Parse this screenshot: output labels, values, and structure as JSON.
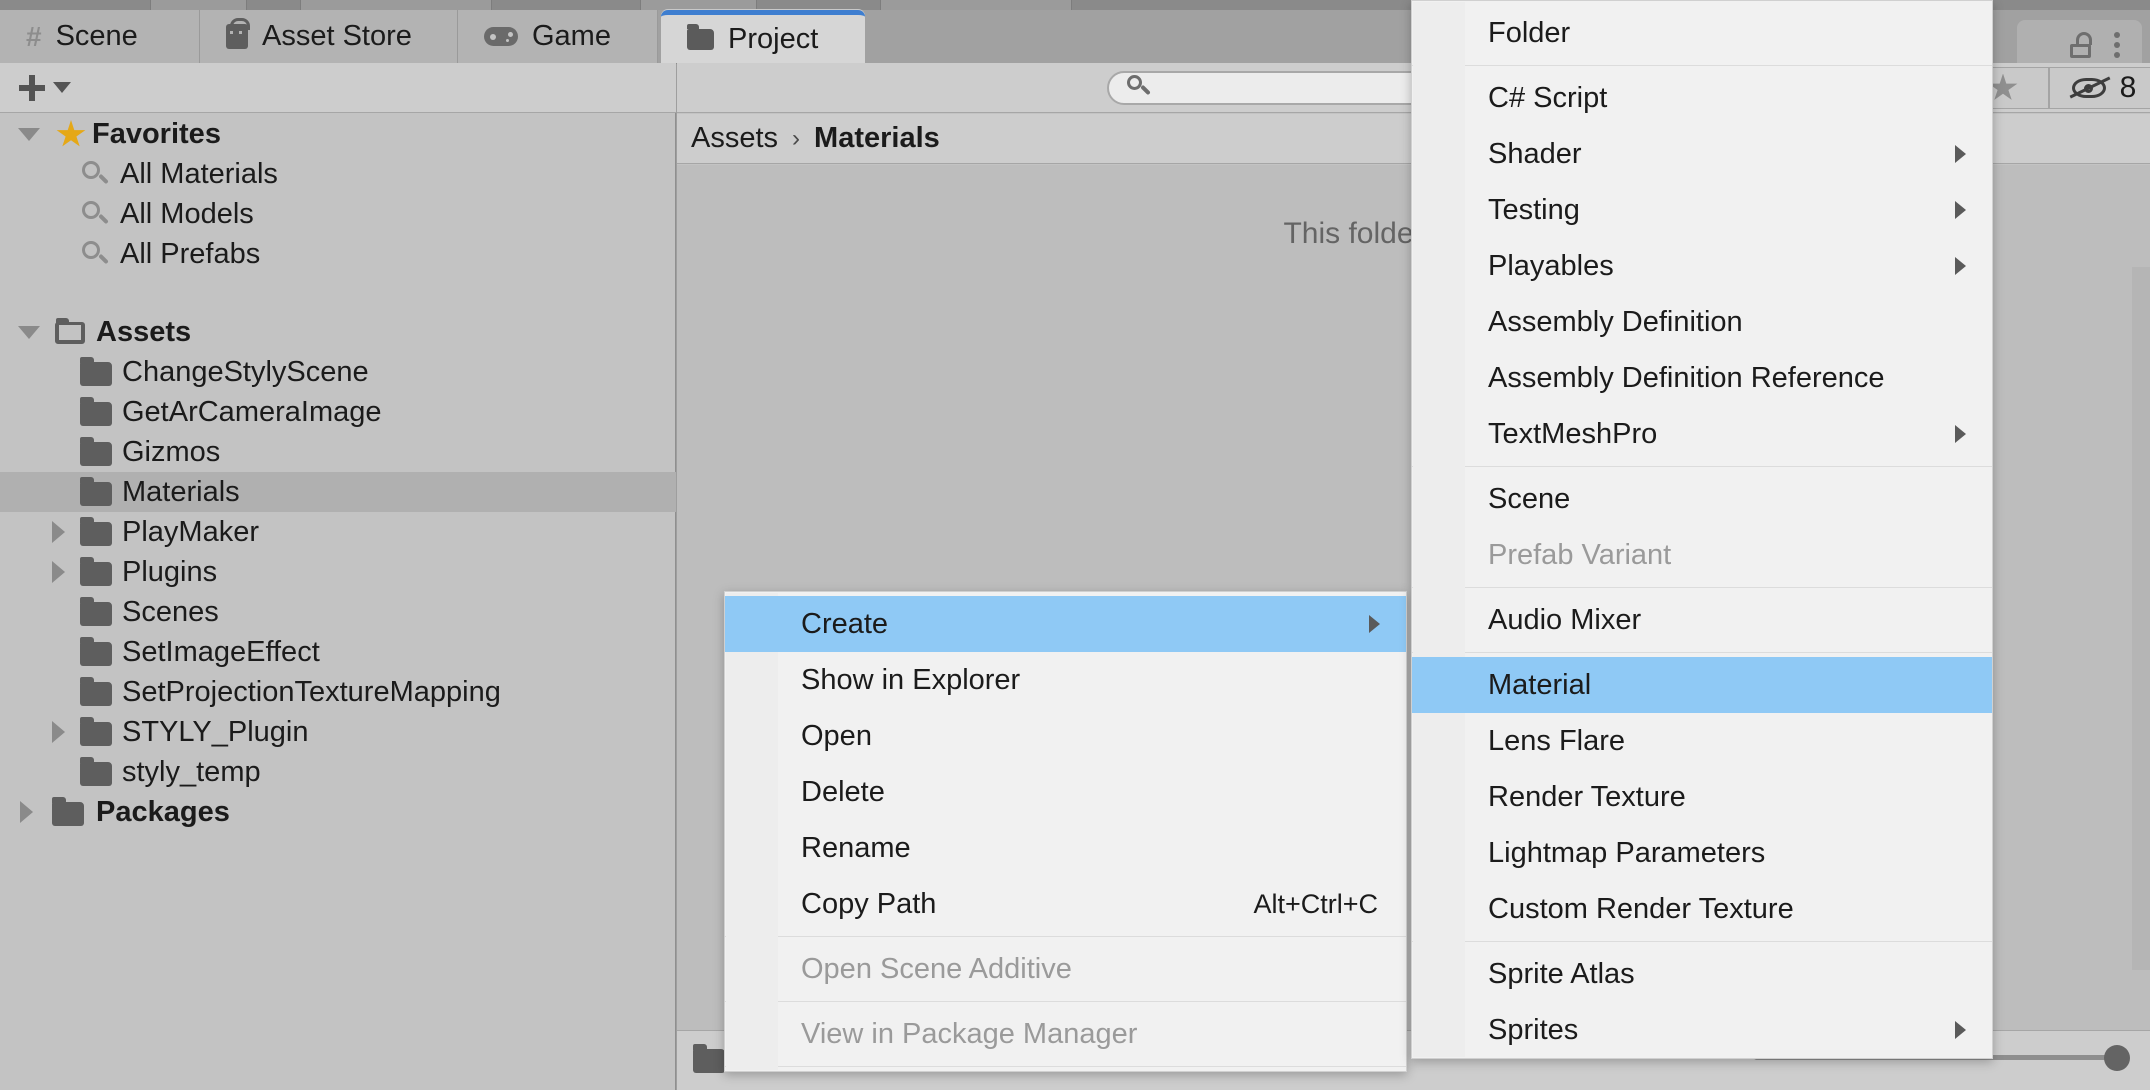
{
  "window": {
    "tabs": [
      {
        "label": "Scene",
        "icon": "grid-icon",
        "active": false
      },
      {
        "label": "Asset Store",
        "icon": "shopping-bag-icon",
        "active": false
      },
      {
        "label": "Game",
        "icon": "gamepad-icon",
        "active": false
      },
      {
        "label": "Project",
        "icon": "folder-icon",
        "active": true
      }
    ],
    "lock_icon": "lock-icon",
    "menu_icon": "kebab-menu-icon",
    "accent_color": "#3e7ed0"
  },
  "left_panel": {
    "toolbar": {
      "add_label": "+",
      "add_icon": "plus-icon",
      "dropdown_icon": "chevron-down-icon"
    },
    "tree": [
      {
        "label": "Favorites",
        "icon": "star-icon",
        "indent": 58,
        "twisty": "down",
        "bold": true,
        "selected": false
      },
      {
        "label": "All Materials",
        "icon": "search-icon",
        "indent": 108,
        "twisty": "none",
        "bold": false,
        "selected": false
      },
      {
        "label": "All Models",
        "icon": "search-icon",
        "indent": 108,
        "twisty": "none",
        "bold": false,
        "selected": false
      },
      {
        "label": "All Prefabs",
        "icon": "search-icon",
        "indent": 108,
        "twisty": "none",
        "bold": false,
        "selected": false
      },
      {
        "label": "",
        "icon": "none",
        "indent": 0,
        "twisty": "none",
        "bold": false,
        "selected": false,
        "spacer": true
      },
      {
        "label": "Assets",
        "icon": "folder-open-icon",
        "indent": 58,
        "twisty": "down",
        "bold": true,
        "selected": false
      },
      {
        "label": "ChangeStylyScene",
        "icon": "folder-icon",
        "indent": 108,
        "twisty": "none",
        "bold": false,
        "selected": false
      },
      {
        "label": "GetArCameraImage",
        "icon": "folder-icon",
        "indent": 108,
        "twisty": "none",
        "bold": false,
        "selected": false
      },
      {
        "label": "Gizmos",
        "icon": "folder-icon",
        "indent": 108,
        "twisty": "none",
        "bold": false,
        "selected": false
      },
      {
        "label": "Materials",
        "icon": "folder-icon",
        "indent": 108,
        "twisty": "none",
        "bold": false,
        "selected": true
      },
      {
        "label": "PlayMaker",
        "icon": "folder-icon",
        "indent": 108,
        "twisty": "right",
        "bold": false,
        "selected": false
      },
      {
        "label": "Plugins",
        "icon": "folder-icon",
        "indent": 108,
        "twisty": "right",
        "bold": false,
        "selected": false
      },
      {
        "label": "Scenes",
        "icon": "folder-icon",
        "indent": 108,
        "twisty": "none",
        "bold": false,
        "selected": false
      },
      {
        "label": "SetImageEffect",
        "icon": "folder-icon",
        "indent": 108,
        "twisty": "none",
        "bold": false,
        "selected": false
      },
      {
        "label": "SetProjectionTextureMapping",
        "icon": "folder-icon",
        "indent": 108,
        "twisty": "none",
        "bold": false,
        "selected": false
      },
      {
        "label": "STYLY_Plugin",
        "icon": "folder-icon",
        "indent": 108,
        "twisty": "right",
        "bold": false,
        "selected": false
      },
      {
        "label": "styly_temp",
        "icon": "folder-icon",
        "indent": 108,
        "twisty": "none",
        "bold": false,
        "selected": false
      },
      {
        "label": "Packages",
        "icon": "folder-icon",
        "indent": 58,
        "twisty": "right",
        "bold": true,
        "selected": false
      }
    ]
  },
  "right_panel": {
    "search": {
      "value": "",
      "placeholder": "",
      "icon": "search-icon"
    },
    "favorites_button": {
      "icon": "star-icon"
    },
    "hidden_button": {
      "icon": "eye-off-icon",
      "count": "8"
    },
    "breadcrumb": {
      "root": "Assets",
      "separator": "›",
      "current": "Materials"
    },
    "empty_message": "This folder is empty",
    "status_bar": {
      "icon": "folder-icon"
    },
    "zoom_slider": {
      "value": "100"
    }
  },
  "context_menu": {
    "items": [
      {
        "label": "Create",
        "highlight": true,
        "disabled": false,
        "submenu": true,
        "shortcut": ""
      },
      {
        "label": "Show in Explorer",
        "highlight": false,
        "disabled": false,
        "submenu": false,
        "shortcut": ""
      },
      {
        "label": "Open",
        "highlight": false,
        "disabled": false,
        "submenu": false,
        "shortcut": ""
      },
      {
        "label": "Delete",
        "highlight": false,
        "disabled": false,
        "submenu": false,
        "shortcut": ""
      },
      {
        "label": "Rename",
        "highlight": false,
        "disabled": false,
        "submenu": false,
        "shortcut": ""
      },
      {
        "label": "Copy Path",
        "highlight": false,
        "disabled": false,
        "submenu": false,
        "shortcut": "Alt+Ctrl+C"
      },
      {
        "separator": true
      },
      {
        "label": "Open Scene Additive",
        "highlight": false,
        "disabled": true,
        "submenu": false,
        "shortcut": ""
      },
      {
        "separator": true
      },
      {
        "label": "View in Package Manager",
        "highlight": false,
        "disabled": true,
        "submenu": false,
        "shortcut": ""
      },
      {
        "separator": true
      }
    ]
  },
  "create_submenu": {
    "items": [
      {
        "label": "Folder",
        "highlight": false,
        "disabled": false,
        "submenu": false
      },
      {
        "separator": true
      },
      {
        "label": "C# Script",
        "highlight": false,
        "disabled": false,
        "submenu": false
      },
      {
        "label": "Shader",
        "highlight": false,
        "disabled": false,
        "submenu": true
      },
      {
        "label": "Testing",
        "highlight": false,
        "disabled": false,
        "submenu": true
      },
      {
        "label": "Playables",
        "highlight": false,
        "disabled": false,
        "submenu": true
      },
      {
        "label": "Assembly Definition",
        "highlight": false,
        "disabled": false,
        "submenu": false
      },
      {
        "label": "Assembly Definition Reference",
        "highlight": false,
        "disabled": false,
        "submenu": false
      },
      {
        "label": "TextMeshPro",
        "highlight": false,
        "disabled": false,
        "submenu": true
      },
      {
        "separator": true
      },
      {
        "label": "Scene",
        "highlight": false,
        "disabled": false,
        "submenu": false
      },
      {
        "label": "Prefab Variant",
        "highlight": false,
        "disabled": true,
        "submenu": false
      },
      {
        "separator": true
      },
      {
        "label": "Audio Mixer",
        "highlight": false,
        "disabled": false,
        "submenu": false
      },
      {
        "separator": true
      },
      {
        "label": "Material",
        "highlight": true,
        "disabled": false,
        "submenu": false
      },
      {
        "label": "Lens Flare",
        "highlight": false,
        "disabled": false,
        "submenu": false
      },
      {
        "label": "Render Texture",
        "highlight": false,
        "disabled": false,
        "submenu": false
      },
      {
        "label": "Lightmap Parameters",
        "highlight": false,
        "disabled": false,
        "submenu": false
      },
      {
        "label": "Custom Render Texture",
        "highlight": false,
        "disabled": false,
        "submenu": false
      },
      {
        "separator": true
      },
      {
        "label": "Sprite Atlas",
        "highlight": false,
        "disabled": false,
        "submenu": false
      },
      {
        "label": "Sprites",
        "highlight": false,
        "disabled": false,
        "submenu": true
      }
    ]
  }
}
